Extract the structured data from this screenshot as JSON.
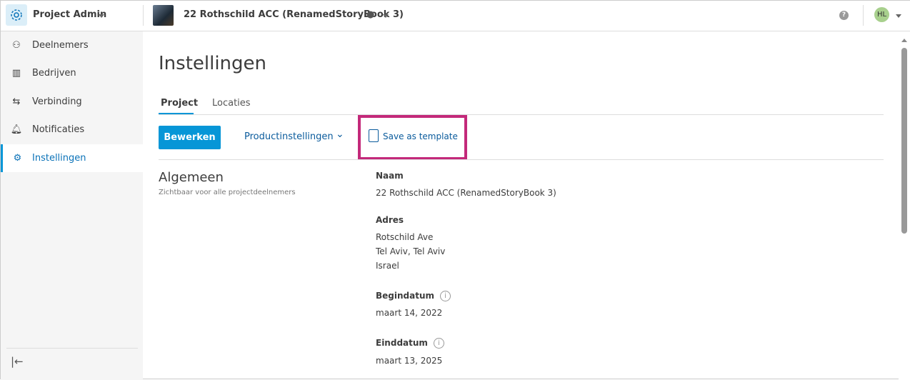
{
  "header": {
    "app_title": "Project Admin",
    "project_name": "22 Rothschild ACC (RenamedStoryBook 3)",
    "avatar_initials": "HL"
  },
  "sidebar": {
    "items": [
      {
        "label": "Deelnemers"
      },
      {
        "label": "Bedrijven"
      },
      {
        "label": "Verbinding"
      },
      {
        "label": "Notificaties"
      },
      {
        "label": "Instellingen"
      }
    ]
  },
  "main": {
    "title": "Instellingen",
    "tabs": [
      {
        "label": "Project"
      },
      {
        "label": "Locaties"
      }
    ],
    "edit_label": "Bewerken",
    "product_settings_label": "Productinstellingen",
    "save_template_label": "Save as template",
    "section_title": "Algemeen",
    "section_subtitle": "Zichtbaar voor alle projectdeelnemers",
    "fields": {
      "name_label": "Naam",
      "name_value": "22 Rothschild ACC (RenamedStoryBook 3)",
      "address_label": "Adres",
      "address_lines": [
        "Rotschild Ave",
        "Tel Aviv, Tel Aviv",
        "Israel"
      ],
      "start_label": "Begindatum",
      "start_value": "maart 14, 2022",
      "end_label": "Einddatum",
      "end_value": "maart 13, 2025"
    }
  },
  "colors": {
    "accent": "#0696d7",
    "highlight": "#c3297a"
  }
}
